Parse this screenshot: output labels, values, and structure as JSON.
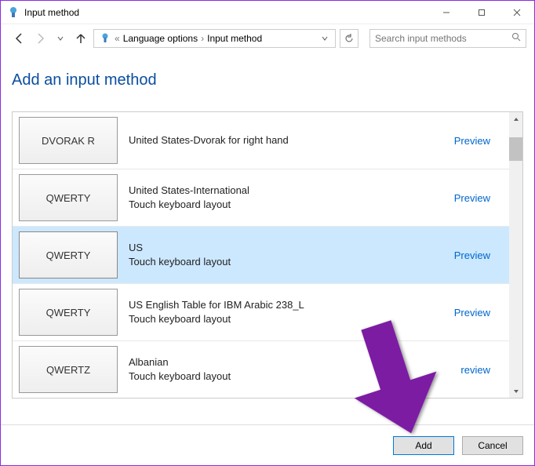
{
  "titlebar": {
    "title": "Input method"
  },
  "nav": {
    "breadcrumb": [
      "Language options",
      "Input method"
    ],
    "chevrons": "«",
    "search_placeholder": "Search input methods"
  },
  "heading": "Add an input method",
  "rows": [
    {
      "layout": "DVORAK R",
      "name": "United States-Dvorak for right hand",
      "sub": "",
      "preview": "Preview",
      "selected": false
    },
    {
      "layout": "QWERTY",
      "name": "United States-International",
      "sub": "Touch keyboard layout",
      "preview": "Preview",
      "selected": false
    },
    {
      "layout": "QWERTY",
      "name": "US",
      "sub": "Touch keyboard layout",
      "preview": "Preview",
      "selected": true
    },
    {
      "layout": "QWERTY",
      "name": "US English Table for IBM Arabic 238_L",
      "sub": "Touch keyboard layout",
      "preview": "Preview",
      "selected": false
    },
    {
      "layout": "QWERTZ",
      "name": "Albanian",
      "sub": "Touch keyboard layout",
      "preview": "review",
      "selected": false
    }
  ],
  "footer": {
    "add": "Add",
    "cancel": "Cancel"
  }
}
